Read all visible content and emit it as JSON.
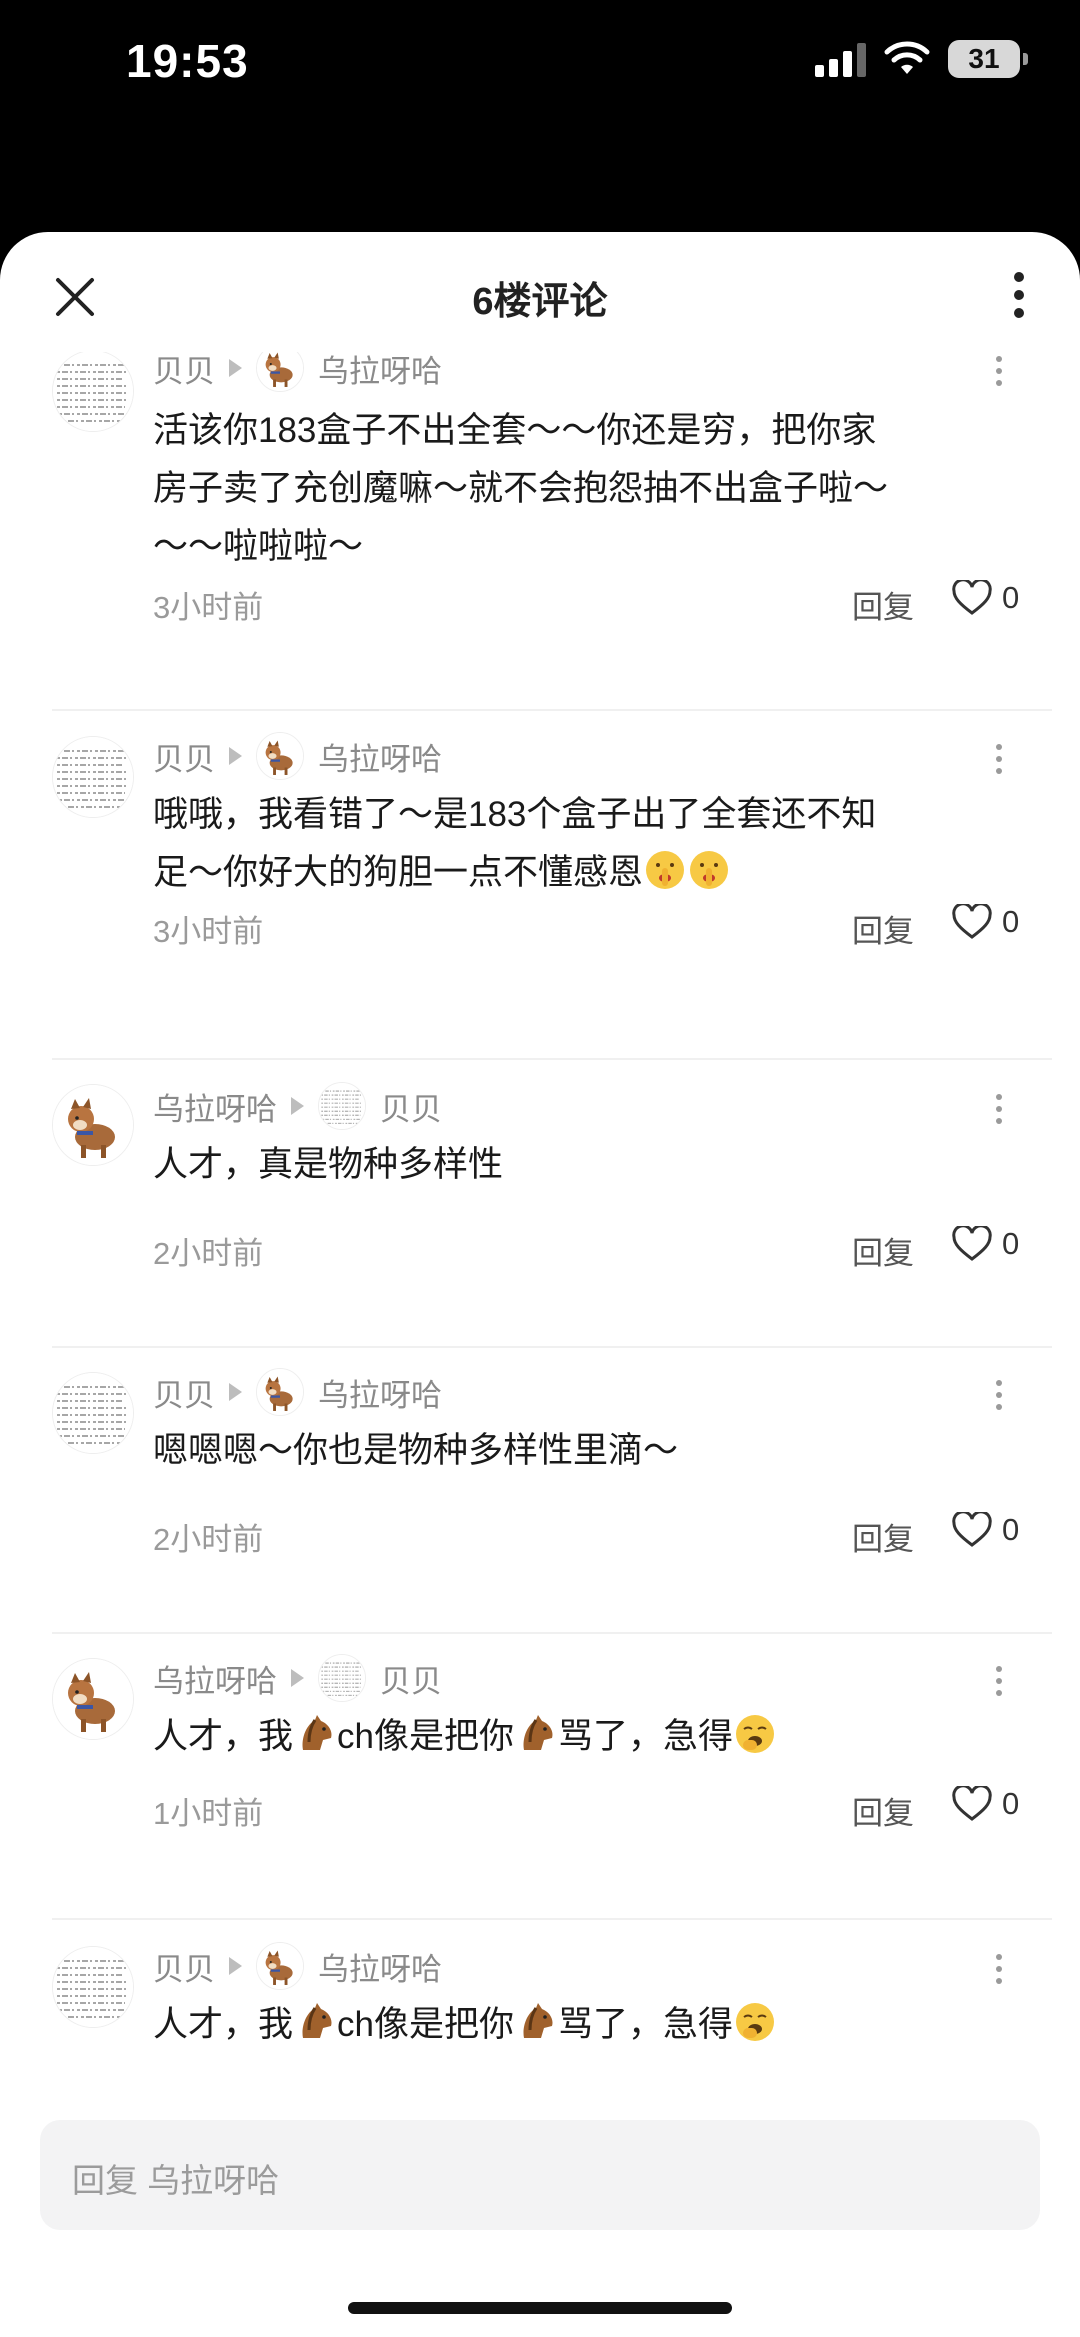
{
  "status_bar": {
    "time": "19:53",
    "battery": "31"
  },
  "sheet": {
    "title": "6楼评论"
  },
  "comments": [
    {
      "author": "贝贝",
      "reply_to": "乌拉呀哈",
      "text_lines": [
        "活该你183盒子不出全套～～你还是穷，把你家",
        "房子卖了充创魔嘛～就不会抱怨抽不出盒子啦～",
        "～～啦啦啦～"
      ],
      "time": "3小时前",
      "reply_label": "回复",
      "likes": "0"
    },
    {
      "author": "贝贝",
      "reply_to": "乌拉呀哈",
      "text_lines": [
        "哦哦，我看错了～是183个盒子出了全套还不知",
        "足～你好大的狗胆一点不懂感恩"
      ],
      "time": "3小时前",
      "reply_label": "回复",
      "likes": "0"
    },
    {
      "author": "乌拉呀哈",
      "reply_to": "贝贝",
      "text_lines": [
        "人才，真是物种多样性"
      ],
      "time": "2小时前",
      "reply_label": "回复",
      "likes": "0"
    },
    {
      "author": "贝贝",
      "reply_to": "乌拉呀哈",
      "text_lines": [
        "嗯嗯嗯～你也是物种多样性里滴～"
      ],
      "time": "2小时前",
      "reply_label": "回复",
      "likes": "0"
    },
    {
      "author": "乌拉呀哈",
      "reply_to": "贝贝",
      "text_parts": [
        "人才，我",
        "ch像是把你",
        "骂了，急得"
      ],
      "time": "1小时前",
      "reply_label": "回复",
      "likes": "0"
    },
    {
      "author": "贝贝",
      "reply_to": "乌拉呀哈",
      "text_parts": [
        "人才，我",
        "ch像是把你",
        "骂了，急得"
      ]
    }
  ],
  "reply_bar": {
    "placeholder": "回复 乌拉呀哈"
  },
  "icons": {
    "close": "close-icon",
    "more": "more-vertical-icon",
    "like": "heart-outline-icon",
    "horse_emoji": "horse-face-emoji",
    "shush_emoji": "shushing-face-emoji",
    "yawn_emoji": "yawning-face-emoji"
  }
}
